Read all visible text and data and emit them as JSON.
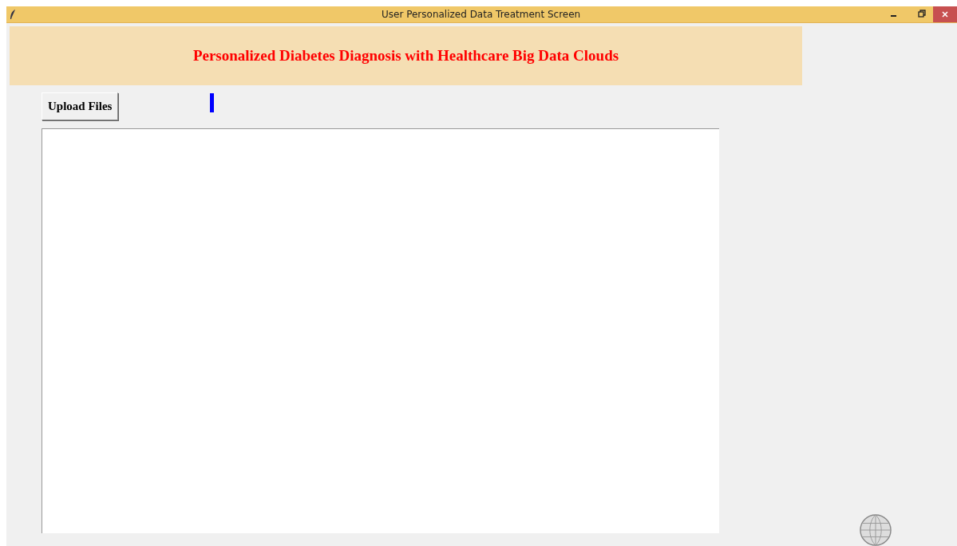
{
  "window": {
    "title": "User Personalized Data Treatment Screen"
  },
  "heading": "Personalized Diabetes Diagnosis with Healthcare Big Data Clouds",
  "buttons": [
    "Upload Files"
  ]
}
